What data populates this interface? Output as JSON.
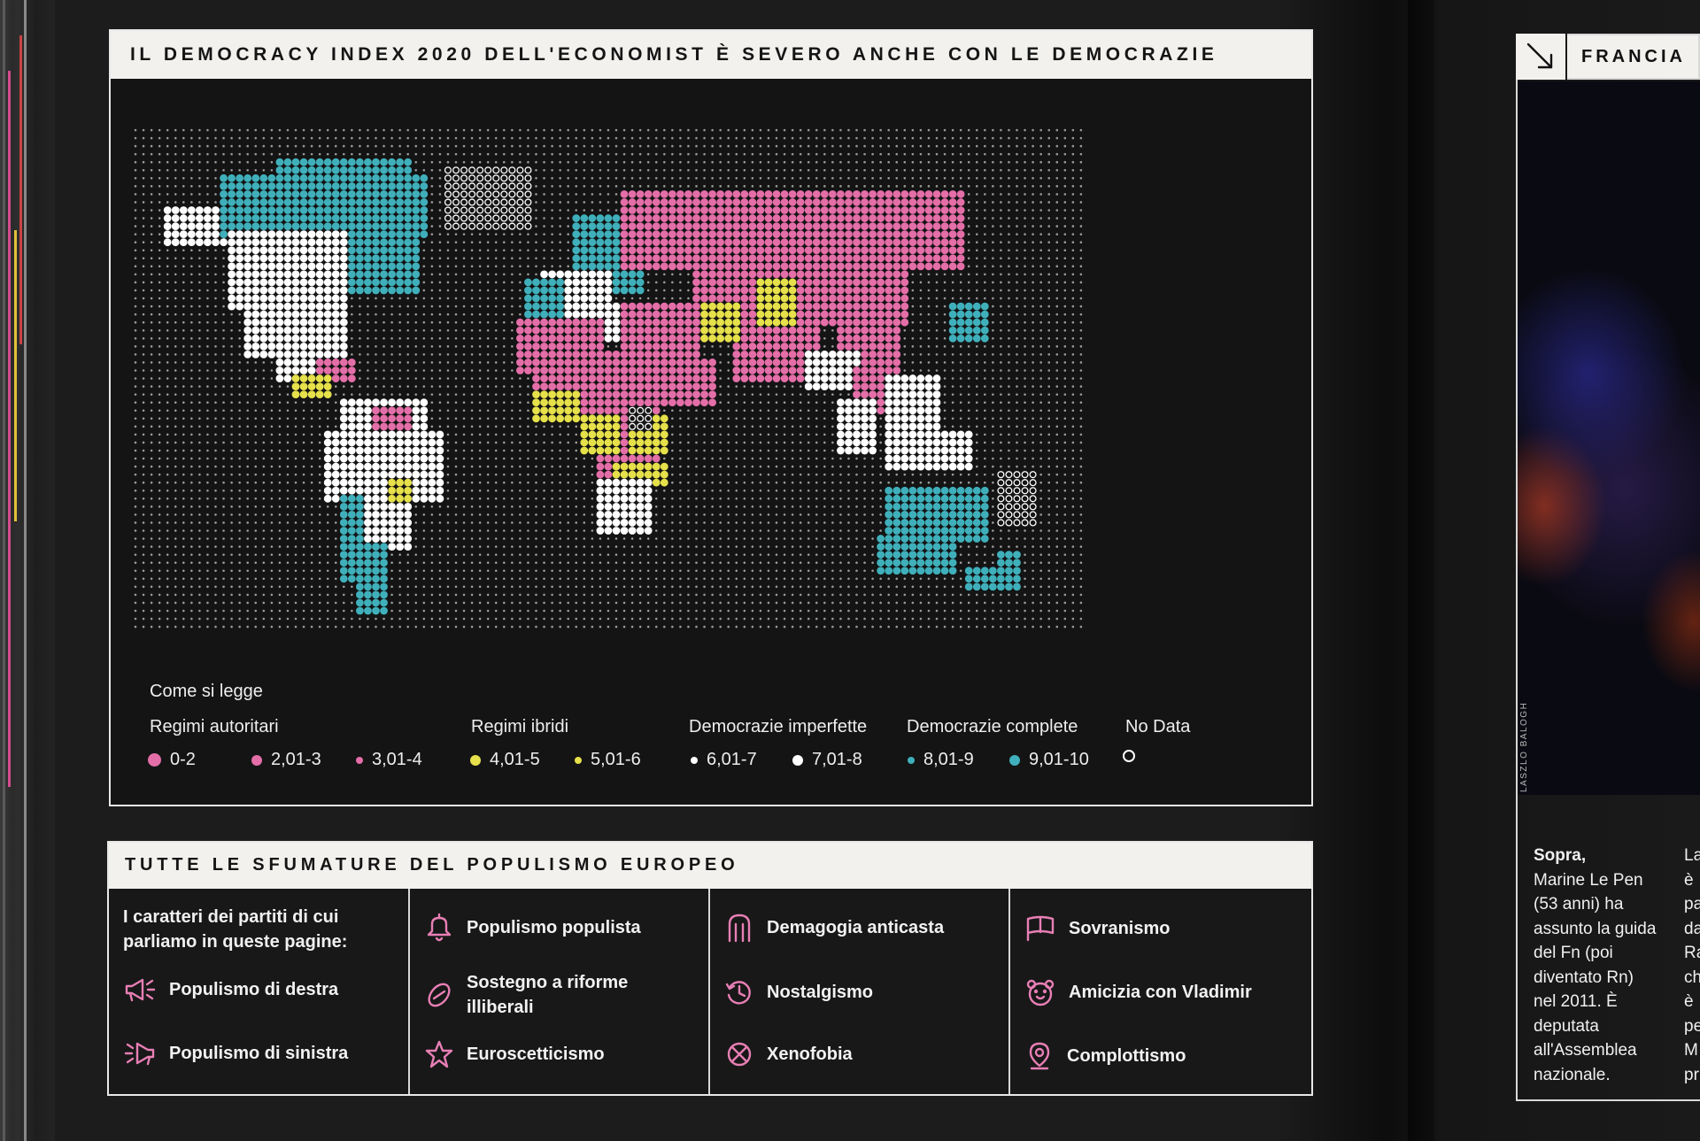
{
  "map": {
    "title": "IL DEMOCRACY INDEX 2020 DELL'ECONOMIST È SEVERO ANCHE CON LE DEMOCRAZIE",
    "legend_heading": "Come si legge",
    "groups": [
      {
        "label": "Regimi autoritari"
      },
      {
        "label": "Regimi ibridi"
      },
      {
        "label": "Democrazie imperfette"
      },
      {
        "label": "Democrazie complete"
      },
      {
        "label": "No Data"
      }
    ],
    "classes": [
      {
        "label": "0-2",
        "color": "#e46ea8"
      },
      {
        "label": "2,01-3",
        "color": "#e46ea8"
      },
      {
        "label": "3,01-4",
        "color": "#e46ea8"
      },
      {
        "label": "4,01-5",
        "color": "#e6e04a"
      },
      {
        "label": "5,01-6",
        "color": "#e6e04a"
      },
      {
        "label": "6,01-7",
        "color": "#ffffff"
      },
      {
        "label": "7,01-8",
        "color": "#ffffff"
      },
      {
        "label": "8,01-9",
        "color": "#3fb0bb"
      },
      {
        "label": "9,01-10",
        "color": "#3fb0bb"
      }
    ],
    "colors": {
      "authoritarian": "#e46ea8",
      "hybrid": "#e6e04a",
      "flawed": "#ffffff",
      "full": "#3fb0bb",
      "grid": "#9a9a9a"
    }
  },
  "populism": {
    "title": "TUTTE LE SFUMATURE DEL POPULISMO EUROPEO",
    "intro": "I caratteri dei partiti di cui parliamo in queste pagine:",
    "icon_color": "#e87fb5",
    "items": [
      {
        "label": "Populismo di destra",
        "icon": "megaphone-right-icon"
      },
      {
        "label": "Populismo di sinistra",
        "icon": "megaphone-left-icon"
      },
      {
        "label": "Populismo populista",
        "icon": "bell-icon"
      },
      {
        "label": "Sostegno a riforme illiberali",
        "icon": "chain-link-icon"
      },
      {
        "label": "Euroscetticismo",
        "icon": "star-icon"
      },
      {
        "label": "Demagogia anticasta",
        "icon": "column-arch-icon"
      },
      {
        "label": "Nostalgismo",
        "icon": "clock-back-icon"
      },
      {
        "label": "Xenofobia",
        "icon": "crossed-circle-icon"
      },
      {
        "label": "Sovranismo",
        "icon": "flag-icon"
      },
      {
        "label": "Amicizia con Vladimir",
        "icon": "bear-icon"
      },
      {
        "label": "Complottismo",
        "icon": "location-pin-icon"
      }
    ]
  },
  "right_page": {
    "section_label": "FRANCIA",
    "photo_credit": "LASZLO BALOGH",
    "caption_lead": "Sopra,",
    "caption_text": "Marine Le Pen (53 anni) ha assunto la guida del Fn (poi diventato Rn) nel 2011. È deputata all'Assemblea nazionale.",
    "next_column_fragments": [
      "La",
      "è",
      "pa",
      "da",
      "Ra",
      "ch",
      "è",
      "pe",
      "M",
      "pr"
    ]
  }
}
